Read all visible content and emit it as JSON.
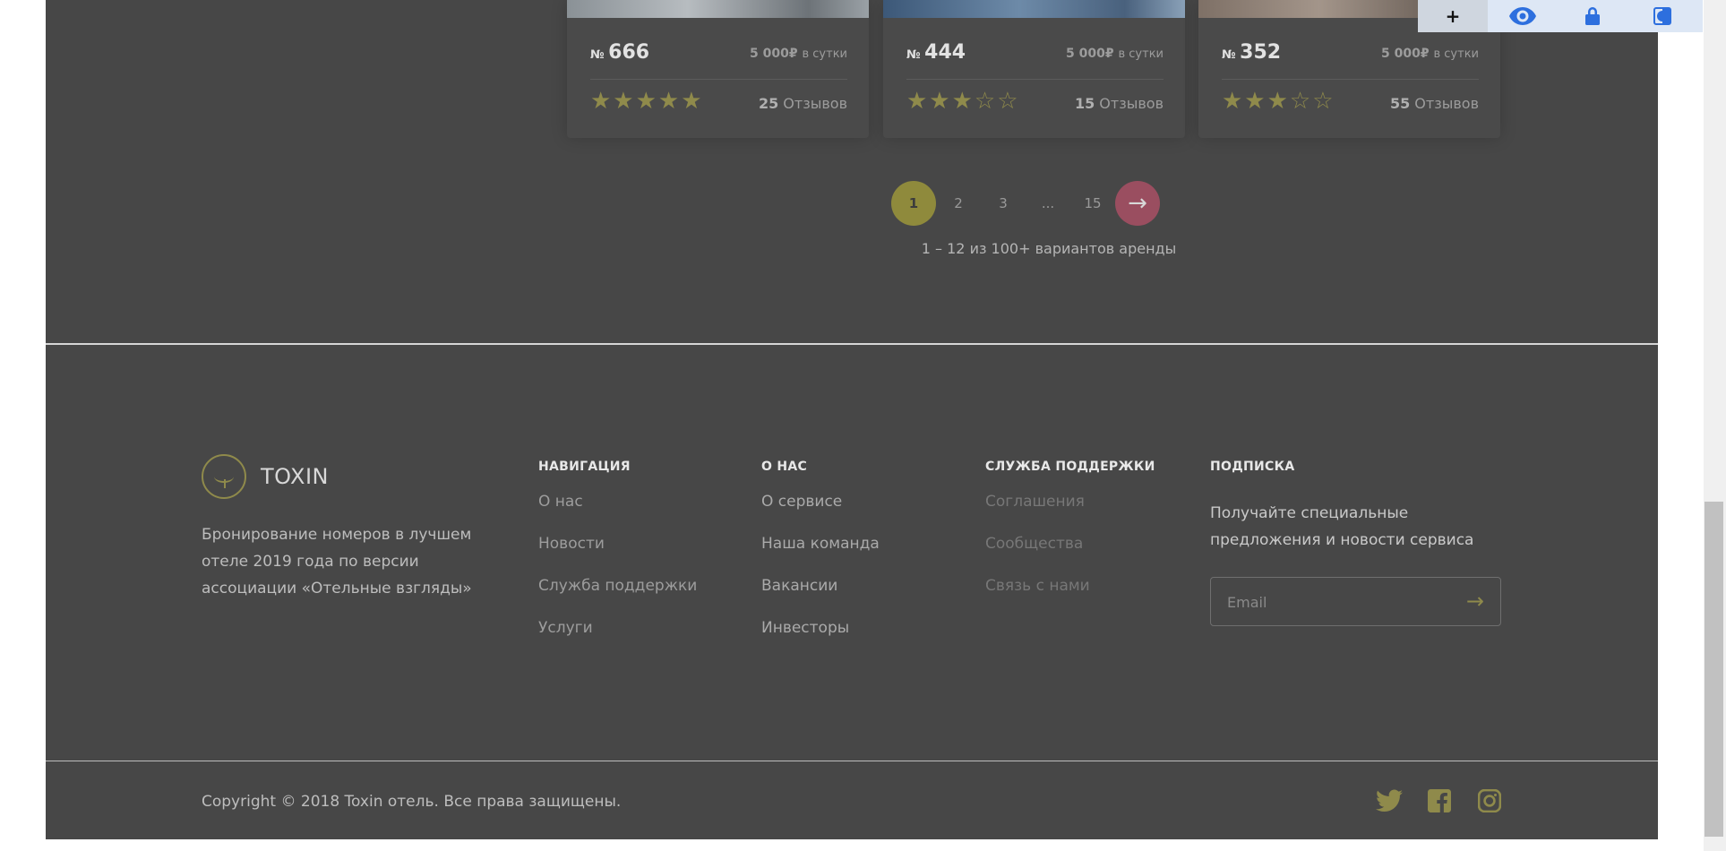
{
  "rooms": [
    {
      "num_prefix": "№",
      "number": "666",
      "price": "5 000₽",
      "price_unit": "в сутки",
      "stars": "★★★★★",
      "reviews_count": "25",
      "reviews_label": "Отзывов",
      "rating": 5
    },
    {
      "num_prefix": "№",
      "number": "444",
      "price": "5 000₽",
      "price_unit": "в сутки",
      "stars": "★★★☆☆",
      "reviews_count": "15",
      "reviews_label": "Отзывов",
      "rating": 3
    },
    {
      "num_prefix": "№",
      "number": "352",
      "price": "5 000₽",
      "price_unit": "в сутки",
      "stars": "★★★☆☆",
      "reviews_count": "55",
      "reviews_label": "Отзывов",
      "rating": 3
    }
  ],
  "pagination": {
    "pages": [
      "1",
      "2",
      "3",
      "...",
      "15"
    ],
    "next_icon": "→",
    "range_text": "1 – 12 из 100+ вариантов аренды"
  },
  "footer": {
    "logo_text": "TOXIN",
    "about": "Бронирование номеров в лучшем отеле 2019 года по версии ассоциации «Отельные взгляды»",
    "columns": [
      {
        "title": "НАВИГАЦИЯ",
        "links": [
          "О нас",
          "Новости",
          "Служба поддержки",
          "Услуги"
        ]
      },
      {
        "title": "О НАС",
        "links": [
          "О сервисе",
          "Наша команда",
          "Вакансии",
          "Инвесторы"
        ]
      },
      {
        "title": "СЛУЖБА ПОДДЕРЖКИ",
        "links": [
          "Соглашения",
          "Сообщества",
          "Связь с нами"
        ]
      },
      {
        "title": "ПОДПИСКА",
        "text": "Получайте специальные предложения и новости сервиса"
      }
    ],
    "email_placeholder": "Email",
    "email_arrow": "→",
    "copyright": "Copyright © 2018 Toxin отель. Все права защищены.",
    "social": [
      "twitter-icon",
      "facebook-icon",
      "instagram-icon"
    ]
  },
  "extension_toolbar": {
    "buttons": [
      "+",
      "eye-icon",
      "lock-icon",
      "contrast-icon"
    ]
  },
  "colors": {
    "accent": "#8f8a4b",
    "next_button": "#9a4e60",
    "background": "#474747"
  }
}
